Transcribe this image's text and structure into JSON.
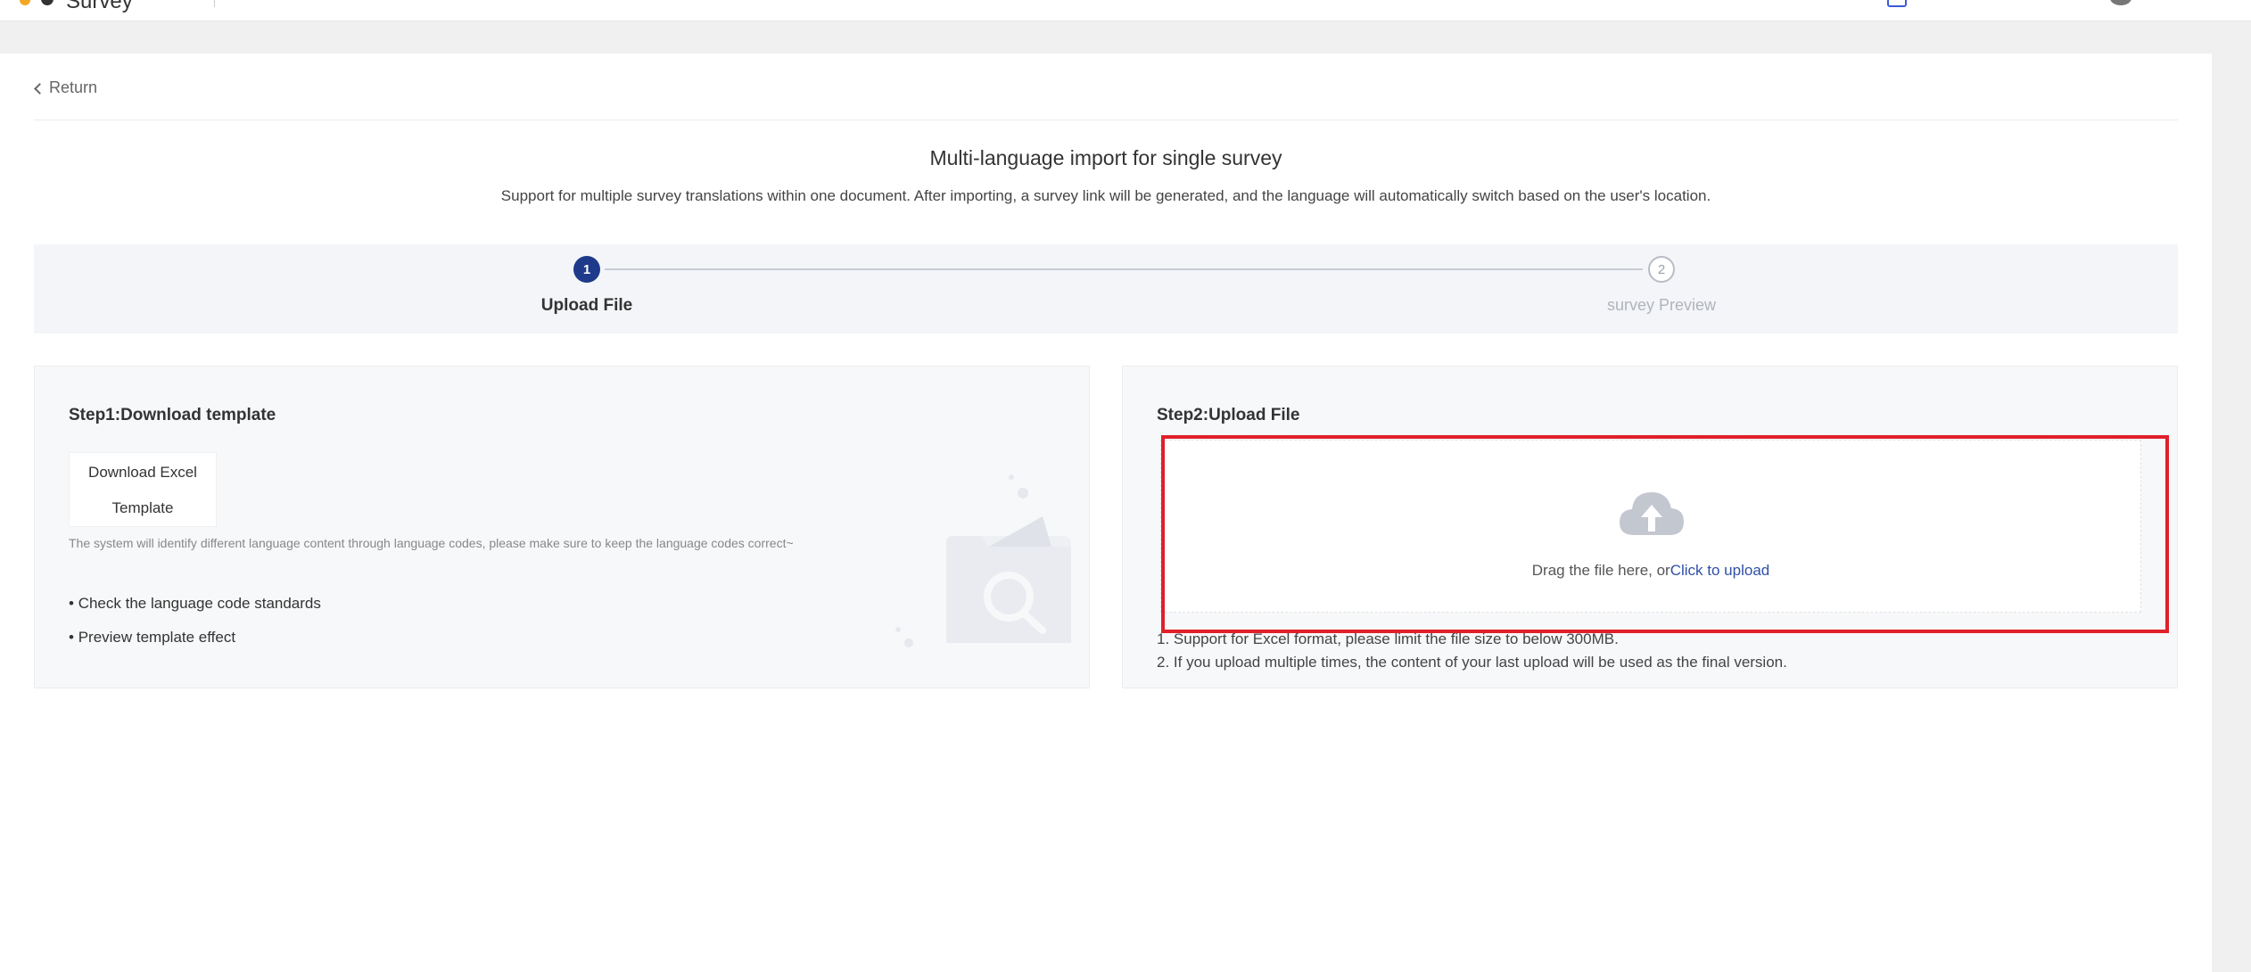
{
  "topbar": {
    "brand": "Survey"
  },
  "nav": {
    "return_label": "Return"
  },
  "page": {
    "title": "Multi-language import for single survey",
    "subtitle": "Support for multiple survey translations within one document. After importing, a survey link will be generated, and the language will automatically switch based on the user's location."
  },
  "stepper": {
    "steps": [
      {
        "number": "1",
        "label": "Upload File",
        "state": "active"
      },
      {
        "number": "2",
        "label": "survey Preview",
        "state": "inactive"
      }
    ],
    "active_color": "#1e3a8a"
  },
  "step1": {
    "heading": "Step1:Download template",
    "download_button_label": "Download Excel Template",
    "hint": "The system will identify different language content through language codes, please make sure to keep the language codes correct~",
    "bullets": [
      "Check the language code standards",
      "Preview template effect"
    ]
  },
  "step2": {
    "heading": "Step2:Upload File",
    "drop_text": "Drag the file here, or",
    "upload_link": "Click to upload",
    "notes": [
      "1. Support for Excel format, please limit the file size to below 300MB.",
      "2. If you upload multiple times, the content of your last upload will be used as the final version."
    ],
    "icon": "cloud-upload-icon"
  },
  "colors": {
    "highlight_border": "#e0202a",
    "link": "#2f4fa8"
  }
}
